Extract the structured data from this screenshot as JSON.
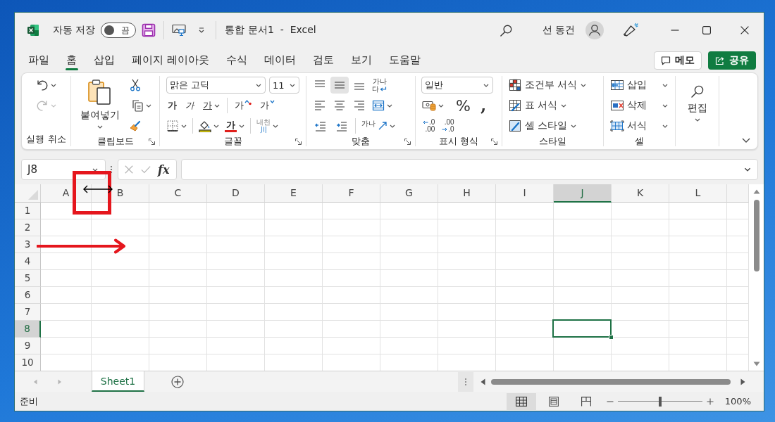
{
  "title_bar": {
    "autosave": {
      "label": "자동 저장",
      "on": false,
      "state_label": "끔"
    },
    "document_title": "통합 문서1  -  Excel",
    "user_name": "선 동건"
  },
  "menu": {
    "tabs": [
      {
        "label": "파일",
        "selected": false
      },
      {
        "label": "홈",
        "selected": true
      },
      {
        "label": "삽입",
        "selected": false
      },
      {
        "label": "페이지 레이아웃",
        "selected": false
      },
      {
        "label": "수식",
        "selected": false
      },
      {
        "label": "데이터",
        "selected": false
      },
      {
        "label": "검토",
        "selected": false
      },
      {
        "label": "보기",
        "selected": false
      },
      {
        "label": "도움말",
        "selected": false
      }
    ],
    "buttons": [
      {
        "kind": "comment",
        "label": "메모"
      },
      {
        "kind": "share",
        "label": "공유"
      }
    ]
  },
  "ribbon": {
    "undo": {
      "label": "실행 취소",
      "undo_disabled": false,
      "redo_disabled": true
    },
    "clipboard": {
      "label": "클립보드",
      "paste": "붙여넣기"
    },
    "font": {
      "label": "글꼴",
      "font_name": "맑은 고딕",
      "font_size": "11",
      "bold": "가",
      "italic": "가",
      "underline": "가",
      "grow": "가",
      "shrink": "가",
      "font_color": "가",
      "phonetic_top": "내천",
      "phonetic_bottom": "川"
    },
    "alignment": {
      "label": "맞춤",
      "vertical": [
        {
          "kind": "top",
          "selected": false
        },
        {
          "kind": "middle",
          "selected": true
        },
        {
          "kind": "bottom",
          "selected": false
        }
      ],
      "horizontal": [
        {
          "kind": "left",
          "selected": false
        },
        {
          "kind": "center",
          "selected": false
        },
        {
          "kind": "right",
          "selected": false
        }
      ],
      "wrap_top": "가나",
      "wrap_bottom": "다",
      "orientation": "가나"
    },
    "number": {
      "label": "표시 형식",
      "format": "일반",
      "percent": "%",
      "comma": ",",
      "increase_decimal": [
        ".0",
        ".00"
      ],
      "decrease_decimal": [
        ".00",
        ".0"
      ]
    },
    "styles": {
      "label": "스타일",
      "items": [
        {
          "kind": "conditional",
          "label": "조건부 서식"
        },
        {
          "kind": "table",
          "label": "표 서식"
        },
        {
          "kind": "cell",
          "label": "셀 스타일"
        }
      ]
    },
    "cells": {
      "label": "셀",
      "items": [
        {
          "kind": "insert",
          "label": "삽입"
        },
        {
          "kind": "delete",
          "label": "삭제"
        },
        {
          "kind": "format",
          "label": "서식"
        }
      ]
    },
    "editing": {
      "label": "편집"
    }
  },
  "formula_bar": {
    "name_box": "J8",
    "function_button": "fx"
  },
  "sheet": {
    "columns": [
      {
        "label": "A",
        "selected": false
      },
      {
        "label": "B",
        "selected": false
      },
      {
        "label": "C",
        "selected": false
      },
      {
        "label": "D",
        "selected": false
      },
      {
        "label": "E",
        "selected": false
      },
      {
        "label": "F",
        "selected": false
      },
      {
        "label": "G",
        "selected": false
      },
      {
        "label": "H",
        "selected": false
      },
      {
        "label": "I",
        "selected": false
      },
      {
        "label": "J",
        "selected": true
      },
      {
        "label": "K",
        "selected": false
      },
      {
        "label": "L",
        "selected": false
      }
    ],
    "rows": [
      {
        "label": "1",
        "selected": false
      },
      {
        "label": "2",
        "selected": false
      },
      {
        "label": "3",
        "selected": false
      },
      {
        "label": "4",
        "selected": false
      },
      {
        "label": "5",
        "selected": false
      },
      {
        "label": "6",
        "selected": false
      },
      {
        "label": "7",
        "selected": false
      },
      {
        "label": "8",
        "selected": true
      },
      {
        "label": "9",
        "selected": false
      },
      {
        "label": "10",
        "selected": false
      }
    ]
  },
  "sheet_tabs": [
    {
      "label": "Sheet1",
      "selected": true
    }
  ],
  "status_bar": {
    "status": "준비",
    "views": [
      {
        "kind": "normal",
        "selected": true
      },
      {
        "kind": "page_layout",
        "selected": false
      },
      {
        "kind": "page_break",
        "selected": false
      }
    ],
    "zoom": {
      "level": 0.5,
      "reading": "100%"
    }
  }
}
